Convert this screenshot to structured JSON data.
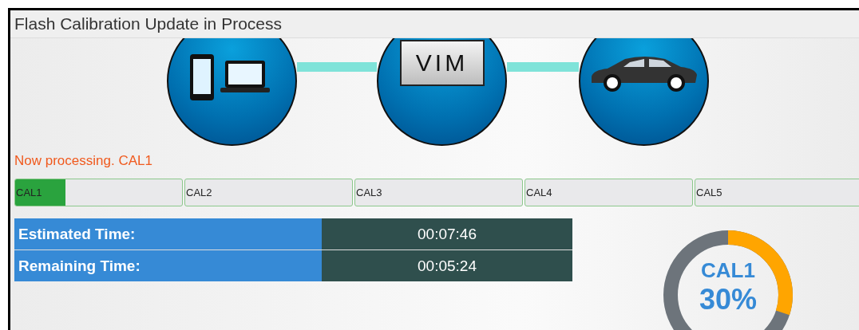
{
  "window": {
    "title": "Flash Calibration Update in Process"
  },
  "diagram": {
    "middle_label": "VIM"
  },
  "status": "Now processing. CAL1",
  "segments": [
    {
      "label": "CAL1",
      "level": 0.3
    },
    {
      "label": "CAL2"
    },
    {
      "label": "CAL3"
    },
    {
      "label": "CAL4"
    },
    {
      "label": "CAL5"
    }
  ],
  "times": [
    {
      "label": "Estimated Time:",
      "value": "00:07:46"
    },
    {
      "label": "Remaining Time:",
      "value": "00:05:24"
    }
  ],
  "donut": {
    "label": "CAL1",
    "percent": "30%",
    "level": 0.3
  }
}
